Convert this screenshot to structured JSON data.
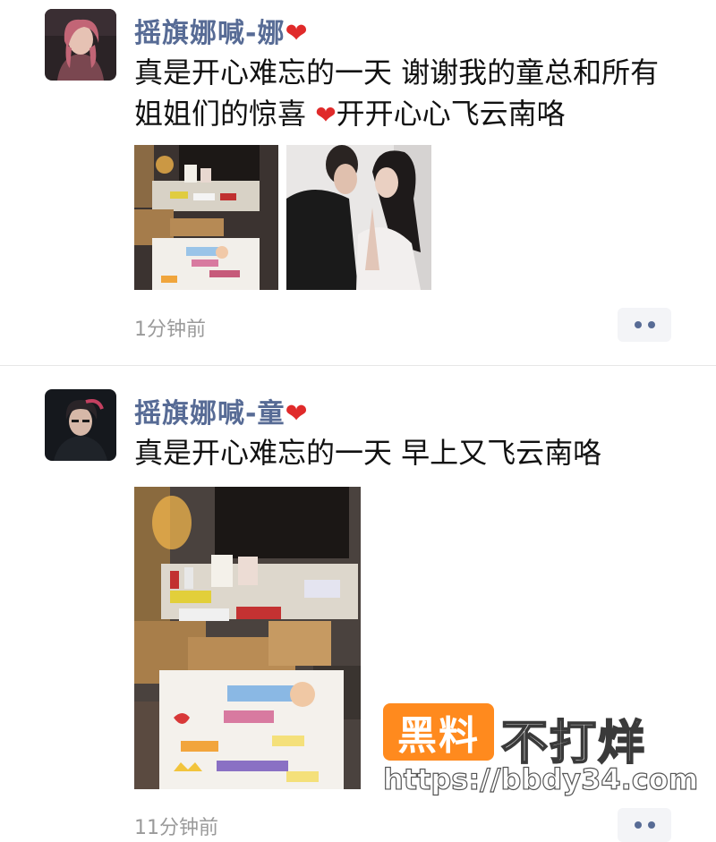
{
  "posts": [
    {
      "username": "摇旗娜喊-娜",
      "heart": "❤",
      "content_line1": "真是开心难忘的一天  谢谢我的童总和所有",
      "content_line2_before": "姐姐们的惊喜 ",
      "content_line2_after": "开开心心飞云南咯",
      "time": "1分钟前"
    },
    {
      "username": "摇旗娜喊-童",
      "heart": "❤",
      "content_line1": "真是开心难忘的一天  早上又飞云南咯",
      "time": "11分钟前"
    }
  ],
  "watermark": {
    "badge": "黑料",
    "text": "不打烊",
    "url": "https://bbdy34.com"
  },
  "colors": {
    "username": "#576b95",
    "heart": "#e02a2a",
    "time": "#9a9a9a",
    "watermark_badge": "#ff8a1e"
  }
}
